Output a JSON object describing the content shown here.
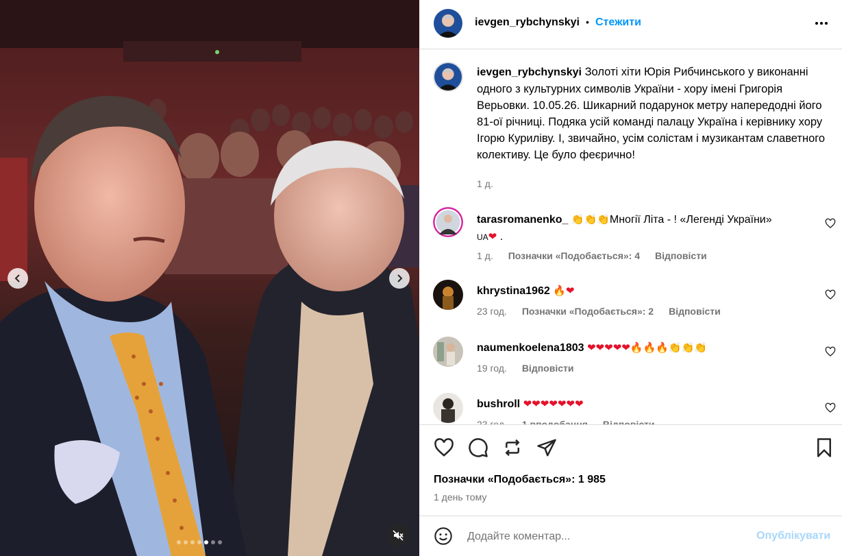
{
  "post": {
    "username": "ievgen_rybchynskyi",
    "separator": "•",
    "follow_label": "Стежити",
    "more_icon": "more-horizontal-icon"
  },
  "media": {
    "prev_icon": "chevron-left-icon",
    "next_icon": "chevron-right-icon",
    "mute_icon": "speaker-muted-icon",
    "slide_count": 7,
    "active_slide": 5
  },
  "caption": {
    "username": "ievgen_rybchynskyi",
    "text": "Золоті хіти Юрія Рибчинського у виконанні одного з культурних символів України - хору імені Григорія Верьовки. 10.05.26. Шикарний подарунок метру напередодні його 81-ої річниці. Подяка усій команді палацу Україна і керівнику хору Ігорю Куриліву. І, звичайно, усім солістам і музикантам славетного колективу. Це було феєрично!",
    "time": "1 д."
  },
  "comments": [
    {
      "username": "tarasromanenko_",
      "text_a": "Многії Літа - ! «Легенді України»",
      "flag": "UA",
      "text_b": ".",
      "time": "1 д.",
      "likes": "Позначки «Подобається»: 4",
      "reply": "Відповісти"
    },
    {
      "username": "khrystina1962",
      "time": "23 год.",
      "likes": "Позначки «Подобається»: 2",
      "reply": "Відповісти"
    },
    {
      "username": "naumenkoelena1803",
      "time": "19 год.",
      "reply": "Відповісти"
    },
    {
      "username": "bushroll",
      "time": "23 год.",
      "likes": "1 вподобання",
      "reply": "Відповісти"
    }
  ],
  "actions": {
    "like_icon": "heart-icon",
    "comment_icon": "comment-bubble-icon",
    "repost_icon": "repost-icon",
    "share_icon": "paper-plane-icon",
    "save_icon": "bookmark-icon"
  },
  "likes_label": "Позначки «Подобається»: 1 985",
  "posted": "1 день тому",
  "composer": {
    "emoji_icon": "emoji-smile-icon",
    "placeholder": "Додайте коментар...",
    "publish_label": "Опублікувати"
  },
  "colors": {
    "link_blue": "#0095f6",
    "publish_disabled": "#a8d7fb",
    "secondary_text": "#737373",
    "divider": "#dbdbdb",
    "heart_red": "#e5112b"
  }
}
